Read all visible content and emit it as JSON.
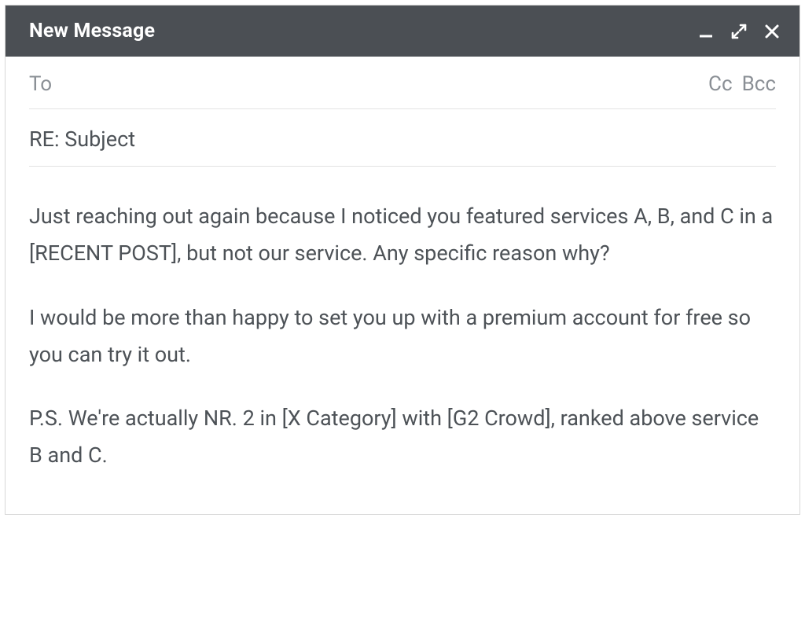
{
  "header": {
    "title": "New Message",
    "icons": {
      "minimize": "minimize-icon",
      "expand": "expand-icon",
      "close": "close-icon"
    }
  },
  "fields": {
    "to_label": "To",
    "cc_label": "Cc",
    "bcc_label": "Bcc",
    "subject_value": "RE: Subject"
  },
  "body": {
    "paragraph1": "Just reaching out again because I noticed you featured services A, B, and C in a [RECENT POST], but not our service. Any specific reason why?",
    "paragraph2": "I would be more than happy to set you up with a premium account for free so you can try it out.",
    "paragraph3": "P.S. We're actually NR. 2 in [X Category] with [G2 Crowd], ranked above service B and C."
  }
}
